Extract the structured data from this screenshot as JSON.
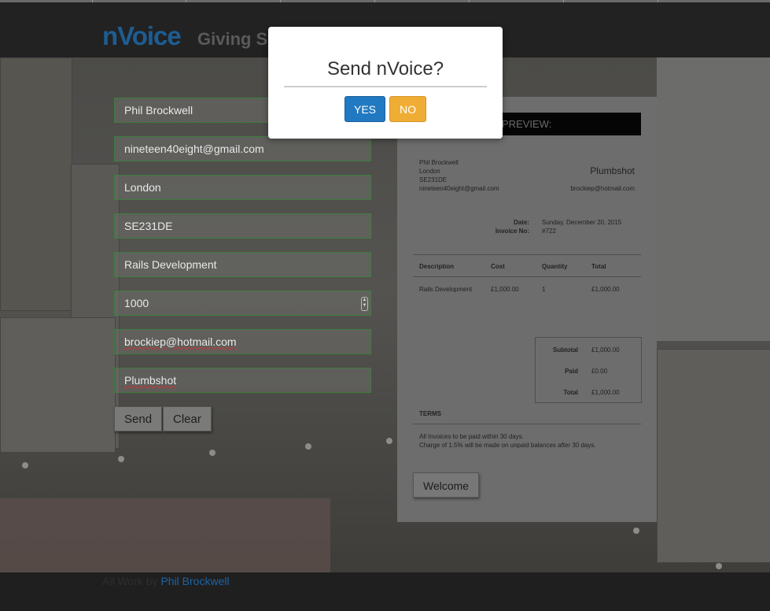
{
  "app": {
    "logo": "nVoice",
    "tagline": "Giving St"
  },
  "form": {
    "name": "Phil Brockwell",
    "email": "nineteen40eight@gmail.com",
    "city": "London",
    "postcode": "SE231DE",
    "description": "Rails Development",
    "cost": "1000",
    "client_email": "brockiep@hotmail.com",
    "client_name": "Plumbshot",
    "send_label": "Send",
    "clear_label": "Clear"
  },
  "preview": {
    "header": "PREVIEW:",
    "sender": {
      "name": "Phil Brockwell",
      "city": "London",
      "postcode": "SE231DE",
      "email": "nineteen40eight@gmail.com"
    },
    "client": {
      "name": "Plumbshot",
      "email": "brockiep@hotmail.com"
    },
    "date_label": "Date:",
    "date_value": "Sunday, December 20, 2015",
    "invoice_label": "Invoice No:",
    "invoice_value": "#722",
    "columns": {
      "description": "Description",
      "cost": "Cost",
      "quantity": "Quantity",
      "total": "Total"
    },
    "row": {
      "description": "Rails Development",
      "cost": "£1,000.00",
      "quantity": "1",
      "total": "£1,000.00"
    },
    "subtotal_label": "Subtotal",
    "subtotal_value": "£1,000.00",
    "paid_label": "Paid",
    "paid_value": "£0.00",
    "total_label": "Total",
    "total_value": "£1,000.00",
    "terms_title": "TERMS",
    "terms_line1": "All Invoices to be paid within 30 days.",
    "terms_line2": "Charge of 1.5% will be made on unpaid balances after 30 days.",
    "welcome_label": "Welcome"
  },
  "footer": {
    "prefix": "All Work by",
    "author": "Phil Brockwell"
  },
  "modal": {
    "title": "Send nVoice?",
    "yes_label": "YES",
    "no_label": "NO"
  },
  "colors": {
    "brand": "#1d5d92",
    "yes": "#2179c1",
    "no": "#f0ad35",
    "field_border": "#3e7e3e"
  }
}
